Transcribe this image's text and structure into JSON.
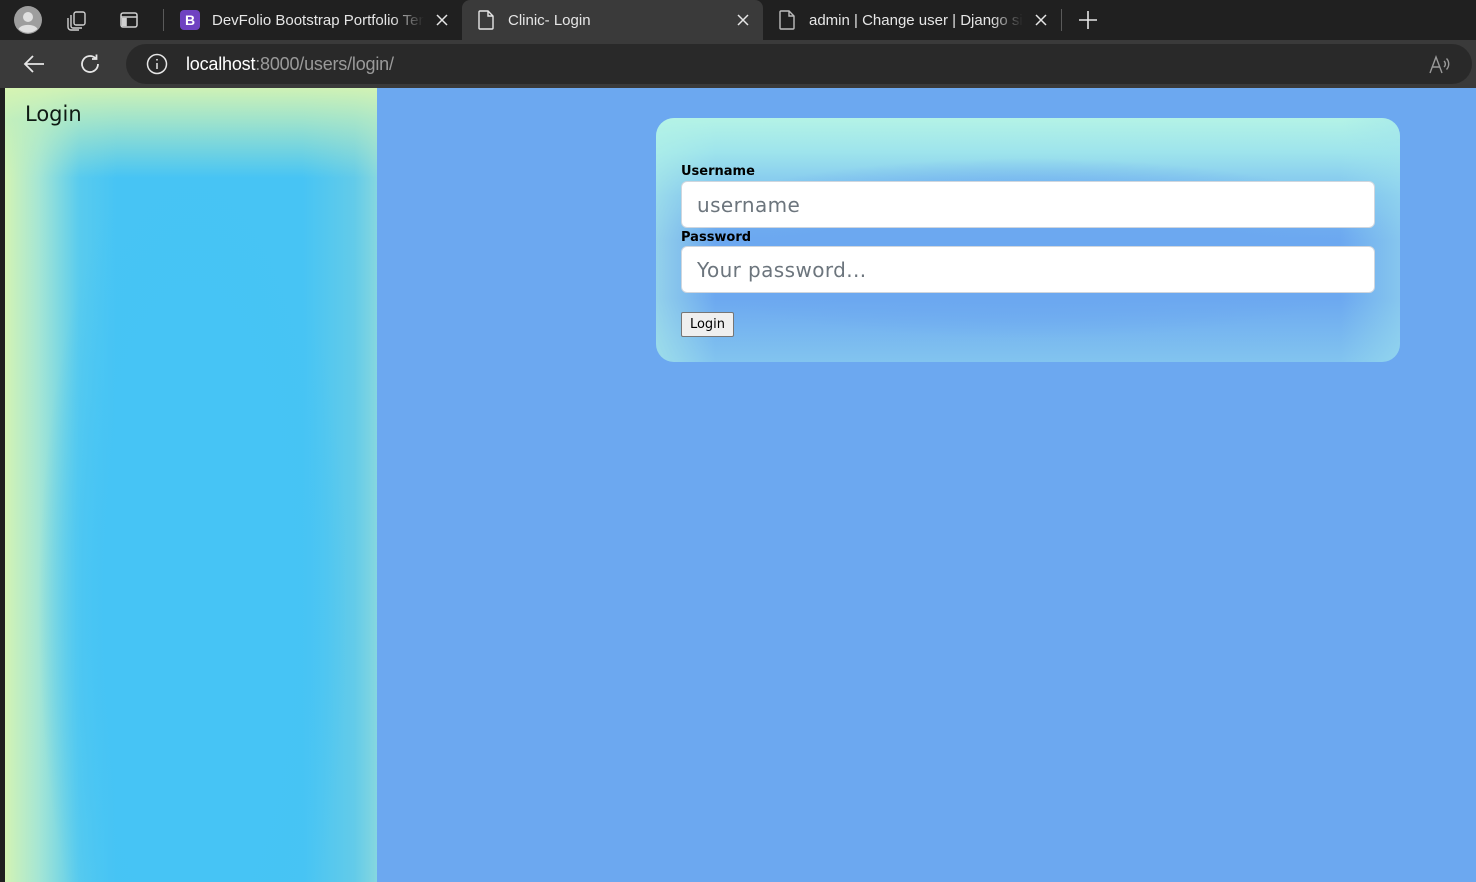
{
  "browser": {
    "tabs": [
      {
        "title": "DevFolio Bootstrap Portfolio Template",
        "favicon": "bootstrap-b-icon",
        "favicon_letter": "B",
        "active": false
      },
      {
        "title": "Clinic- Login",
        "favicon": "page-icon",
        "active": true
      },
      {
        "title": "admin | Change user | Django site admin",
        "favicon": "page-icon",
        "active": false
      }
    ],
    "address": {
      "host": "localhost",
      "path": ":8000/users/login/"
    },
    "icons": {
      "profile": "profile-avatar-icon",
      "workspaces": "workspaces-icon",
      "tab_actions": "tab-actions-icon",
      "new_tab": "plus-icon",
      "back": "back-arrow-icon",
      "reload": "reload-icon",
      "site_info": "info-icon",
      "read_aloud": "read-aloud-icon",
      "close": "close-icon"
    }
  },
  "page": {
    "sidebar_title": "Login",
    "form": {
      "username_label": "Username",
      "username_placeholder": "username",
      "password_label": "Password",
      "password_placeholder": "Your password...",
      "submit_label": "Login"
    }
  },
  "colors": {
    "page_background": "#6ca8f0",
    "sidebar_blue": "#47c4f4",
    "sidebar_green": "#d3f3b4",
    "card_top": "#b4f3e6",
    "browser_dark": "#202020",
    "toolbar": "#3a3a3a"
  }
}
